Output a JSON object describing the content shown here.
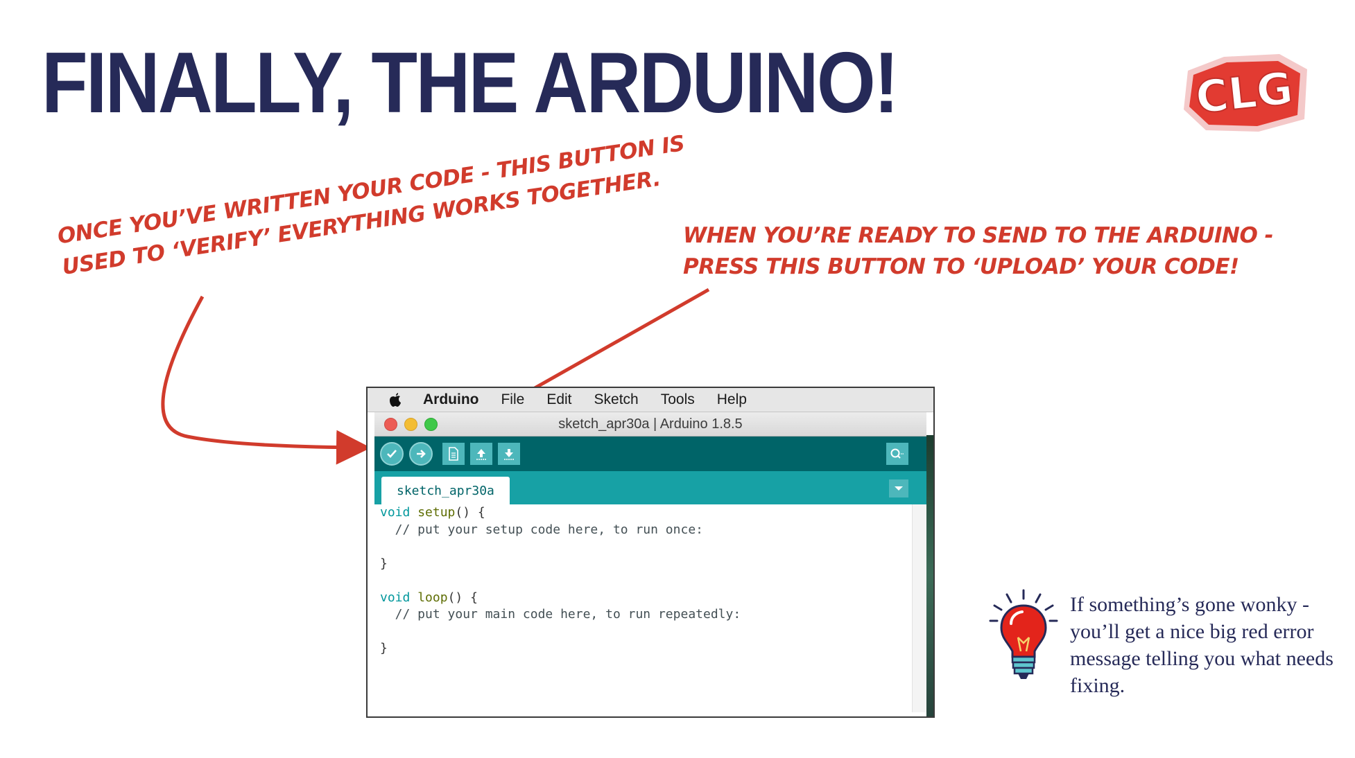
{
  "slide": {
    "title": "FINALLY, THE ARDUINO!",
    "logo_text": "CLG"
  },
  "callouts": {
    "verify_line1": "ONCE YOU’VE WRITTEN YOUR CODE - THIS BUTTON IS",
    "verify_line2": "USED TO ‘VERIFY’ EVERYTHING WORKS TOGETHER.",
    "upload_line1": "WHEN YOU’RE READY TO SEND TO THE ARDUINO -",
    "upload_line2": "PRESS THIS BUTTON TO ‘UPLOAD’ YOUR CODE!"
  },
  "ide": {
    "menubar": {
      "app_name": "Arduino",
      "items": [
        "File",
        "Edit",
        "Sketch",
        "Tools",
        "Help"
      ]
    },
    "window_title": "sketch_apr30a | Arduino 1.8.5",
    "toolbar": {
      "buttons": [
        "verify-button",
        "upload-button",
        "new-button",
        "open-button",
        "save-button"
      ],
      "right_button": "serial-monitor-button"
    },
    "tab_name": "sketch_apr30a",
    "code": {
      "l1_kw": "void",
      "l1_fn": "setup",
      "l1_rest": "() {",
      "l2": "  // put your setup code here, to run once:",
      "l3": "",
      "l4": "}",
      "l5": "",
      "l6_kw": "void",
      "l6_fn": "loop",
      "l6_rest": "() {",
      "l7": "  // put your main code here, to run repeatedly:",
      "l8": "",
      "l9": "}"
    },
    "colors": {
      "toolbar": "#006468",
      "tabstrip": "#17a1a5",
      "button": "#4db7bb"
    }
  },
  "tip": {
    "icon": "lightbulb-icon",
    "text": "If something’s gone wonky - you’ll get a nice big red error message telling you what needs fixing."
  },
  "colors": {
    "title": "#262a58",
    "callout": "#d13b2c"
  }
}
